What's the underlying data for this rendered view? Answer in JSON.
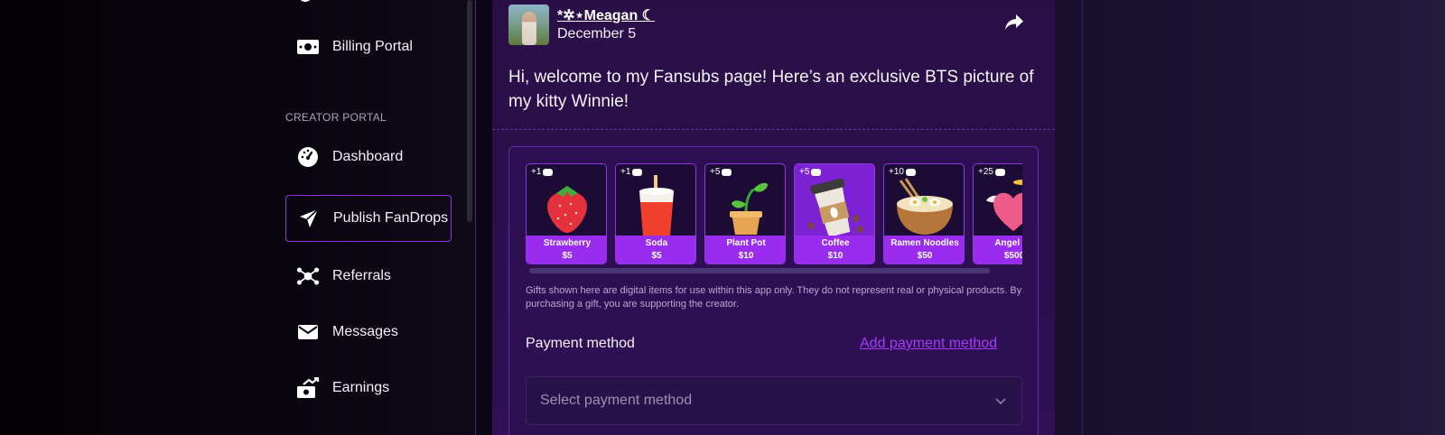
{
  "sidebar": {
    "items_top": [
      {
        "label": "Billing Portal",
        "icon": "money-icon"
      }
    ],
    "section_label": "CREATOR PORTAL",
    "items": [
      {
        "label": "Dashboard",
        "icon": "dashboard-icon"
      },
      {
        "label": "Publish FanDrops",
        "icon": "send-icon",
        "active": true
      },
      {
        "label": "Referrals",
        "icon": "referrals-icon"
      },
      {
        "label": "Messages",
        "icon": "mail-icon"
      },
      {
        "label": "Earnings",
        "icon": "earnings-icon"
      }
    ]
  },
  "post": {
    "username": "*✲⋆Meagan ☾",
    "date": "December 5",
    "text": "Hi, welcome to my Fansubs page! Here’s an exclusive BTS picture of my kitty Winnie!"
  },
  "gifts": [
    {
      "count": "+1",
      "name": "Strawberry",
      "price": "$5"
    },
    {
      "count": "+1",
      "name": "Soda",
      "price": "$5"
    },
    {
      "count": "+5",
      "name": "Plant Pot",
      "price": "$10"
    },
    {
      "count": "+5",
      "name": "Coffee",
      "price": "$10",
      "selected": true
    },
    {
      "count": "+10",
      "name": "Ramen Noodles",
      "price": "$50"
    },
    {
      "count": "+25",
      "name": "Angel He",
      "price": "$500"
    }
  ],
  "disclaimer": "Gifts shown here are digital items for use within this app only. They do not represent real or physical products. By purchasing a gift, you are supporting the creator.",
  "payment": {
    "label": "Payment method",
    "add_link": "Add payment method",
    "select_placeholder": "Select payment method"
  },
  "colors": {
    "accent": "#9a2cf0",
    "link": "#a43cf5",
    "active_border": "#8c2fe8"
  }
}
